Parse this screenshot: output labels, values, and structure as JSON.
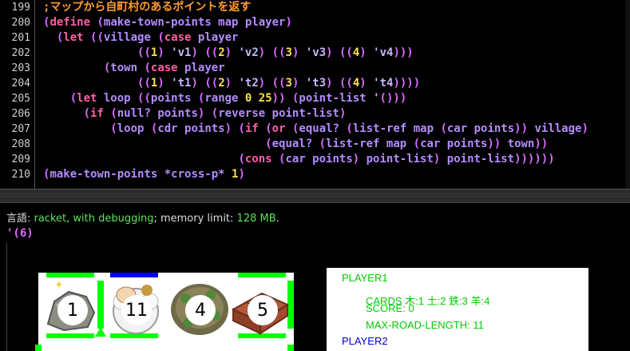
{
  "editor": {
    "line_numbers": [
      "199",
      "200",
      "201",
      "202",
      "203",
      "204",
      "205",
      "206",
      "207",
      "208",
      "209",
      "210"
    ],
    "comment": ";マップから自町村のあるポイントを返す"
  },
  "repl": {
    "lang_prefix": "言語: ",
    "lang_value": "racket, with debugging",
    "mem_prefix": "; memory limit: ",
    "mem_value": "128 MB",
    "mem_suffix": ".",
    "result": "'(6)"
  },
  "board": {
    "tiles": [
      {
        "number": "1",
        "resource": "iron",
        "icon": "rock-icon"
      },
      {
        "number": "11",
        "resource": "sheep",
        "icon": "sheep-icon"
      },
      {
        "number": "4",
        "resource": "wood",
        "icon": "forest-icon"
      },
      {
        "number": "5",
        "resource": "brick",
        "icon": "brick-icon"
      }
    ],
    "road_colors": {
      "player1": "#00ff00",
      "player2": "#0000ff"
    }
  },
  "panel": {
    "player1_name": "PLAYER1",
    "player1_cards": "CARDS 木:1 土:2 鉄:3 羊:4",
    "player1_score": "SCORE: 0",
    "player1_max_road": "MAX-ROAD-LENGTH: 11",
    "player2_name": "PLAYER2",
    "player1_color": "#00cc00",
    "player2_color": "#0000cc"
  }
}
